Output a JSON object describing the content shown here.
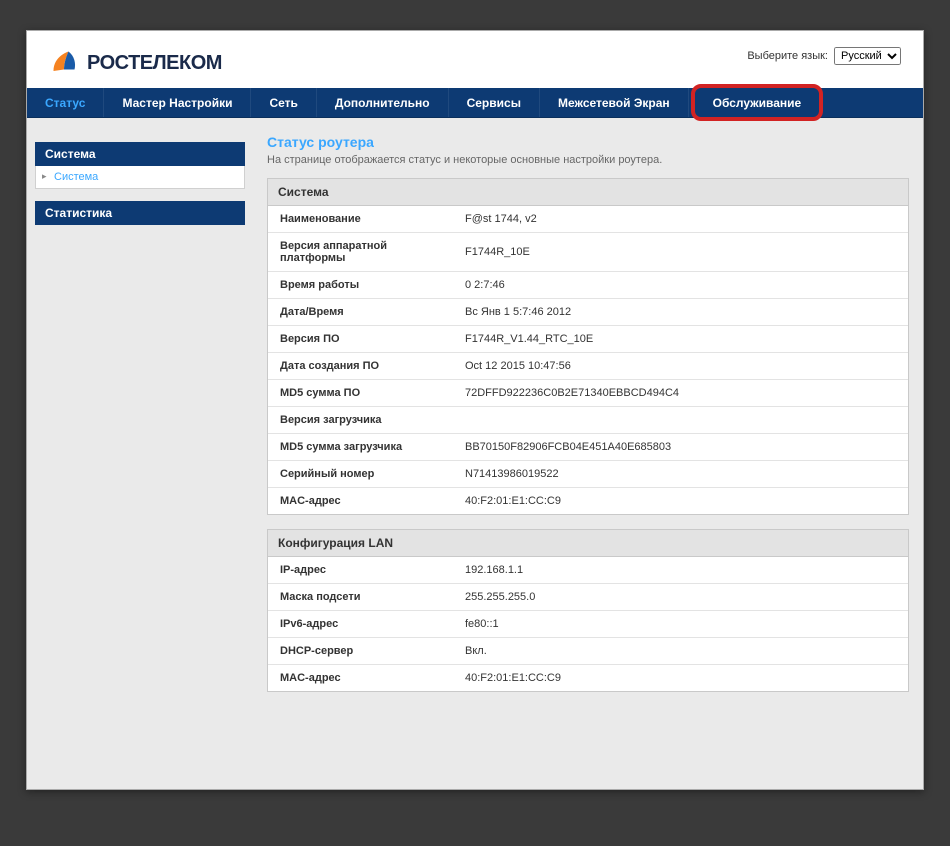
{
  "header": {
    "brand": "РОСТЕЛЕКОМ",
    "lang_label": "Выберите язык:",
    "lang_value": "Русский"
  },
  "nav": {
    "status": "Статус",
    "wizard": "Мастер Настройки",
    "network": "Сеть",
    "advanced": "Дополнительно",
    "services": "Сервисы",
    "firewall": "Межсетевой Экран",
    "maintenance": "Обслуживание"
  },
  "sidebar": {
    "system_header": "Система",
    "system_item": "Система",
    "stats_header": "Статистика"
  },
  "page": {
    "title": "Статус роутера",
    "subtitle": "На странице отображается статус и некоторые основные настройки роутера."
  },
  "panel_system": {
    "title": "Система",
    "rows": [
      {
        "label": "Наименование",
        "value": "F@st 1744, v2"
      },
      {
        "label": "Версия аппаратной платформы",
        "value": "F1744R_10E"
      },
      {
        "label": "Время работы",
        "value": "0 2:7:46"
      },
      {
        "label": "Дата/Время",
        "value": "Вс Янв 1 5:7:46 2012"
      },
      {
        "label": "Версия ПО",
        "value": "F1744R_V1.44_RTC_10E"
      },
      {
        "label": "Дата создания ПО",
        "value": "Oct 12 2015 10:47:56"
      },
      {
        "label": "MD5 сумма ПО",
        "value": "72DFFD922236C0B2E71340EBBCD494C4"
      },
      {
        "label": "Версия загрузчика",
        "value": ""
      },
      {
        "label": "MD5 сумма загрузчика",
        "value": "BB70150F82906FCB04E451A40E685803"
      },
      {
        "label": "Серийный номер",
        "value": "N71413986019522"
      },
      {
        "label": "MAC-адрес",
        "value": "40:F2:01:E1:CC:C9"
      }
    ]
  },
  "panel_lan": {
    "title": "Конфигурация LAN",
    "rows": [
      {
        "label": "IP-адрес",
        "value": "192.168.1.1"
      },
      {
        "label": "Маска подсети",
        "value": "255.255.255.0"
      },
      {
        "label": "IPv6-адрес",
        "value": "fe80::1"
      },
      {
        "label": "DHCP-сервер",
        "value": "Вкл."
      },
      {
        "label": "MAC-адрес",
        "value": "40:F2:01:E1:CC:C9"
      }
    ]
  }
}
